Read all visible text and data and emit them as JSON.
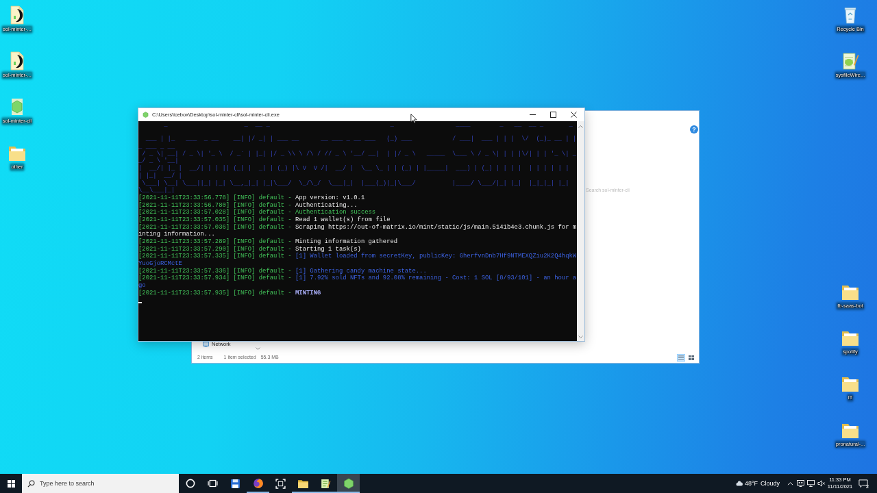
{
  "desktop": {
    "left_icons": [
      {
        "label": "sol-minter-...",
        "kind": "document"
      },
      {
        "label": "sol-minter-...",
        "kind": "document"
      },
      {
        "label": "sol-minter-cli",
        "kind": "hexagon_app"
      },
      {
        "label": "other",
        "kind": "folder"
      }
    ],
    "right_icons": [
      {
        "label": "Recycle Bin",
        "kind": "recycle_bin"
      },
      {
        "label": "sysfileWire...",
        "kind": "notepad"
      },
      {
        "label": "fb-saas-bot",
        "kind": "folder"
      },
      {
        "label": "spotify",
        "kind": "folder"
      },
      {
        "label": "IT",
        "kind": "folder"
      },
      {
        "label": "pronatural-...",
        "kind": "folder"
      }
    ]
  },
  "explorer_window": {
    "help": "?",
    "search": {
      "placeholder": "Search sol-minter-cli"
    },
    "nav_items": [
      {
        "label": "Network",
        "kind": "network"
      }
    ],
    "status_bar": {
      "texts": [
        "2 items",
        "1 item selected",
        "55.3 MB"
      ],
      "view_buttons": [
        {
          "kind": "details",
          "selected": true
        },
        {
          "kind": "tiles",
          "selected": false
        }
      ]
    }
  },
  "console_window": {
    "title": "C:\\Users\\icebox\\Desktop\\sol-minter-cli\\sol-minter-cli.exe",
    "banner": [
      "       _                     _  __ _                                 _                 ____        _   __  __ _       _            ",
      "  ___ | |_   ___  _ __    __| |/ _| | ___ __      __ ___ _ __ ___   (_) ___           / ___|  ___ | | |  \\/  (_)_ __ | |_ ___ _ __ ",
      " / _ \\| __| / _ \\| '_ \\  / _` | |_| |/ _ \\\\ \\ /\\ / // _ \\ '__/ __|  | |/ _ \\   _____  \\___ \\ / _ \\| | | |\\/| | | '_ \\| __/ _ \\ '__|",
      "|  __/| |_ |  __/| | | || (_| |  _| | (_) |\\ V  V /|  __/ |  \\__ \\_ | | (_) | |_____|  ___) | (_) | | | |  | | | | | | | |_|  __/ |  ",
      " \\___| \\__| \\___||_| |_| \\__,_|_| |_|\\___/  \\_/\\_/  \\___|_|  |___(_)|_|\\___/          |____/ \\___/|_| |_|  |_|_|_| |_| \\__\\___|_|  "
    ],
    "log": [
      {
        "prefix": "[2021-11-11T23:33:56.778] [INFO] default -",
        "message": "App version: v1.0.1",
        "kind": "plain"
      },
      {
        "prefix": "[2021-11-11T23:33:56.780] [INFO] default -",
        "message": "Authenticating...",
        "kind": "plain"
      },
      {
        "prefix": "[2021-11-11T23:33:57.028] [INFO] default -",
        "message": "Authentication success",
        "kind": "success"
      },
      {
        "prefix": "[2021-11-11T23:33:57.035] [INFO] default -",
        "message": "Read 1 wallet(s) from file",
        "kind": "plain"
      },
      {
        "prefix": "[2021-11-11T23:33:57.036] [INFO] default -",
        "message": "Scraping https://out-of-matrix.io/mint/static/js/main.5141b4e3.chunk.js for minting information...",
        "kind": "plain"
      },
      {
        "prefix": "[2021-11-11T23:33:57.289] [INFO] default -",
        "message": "Minting information gathered",
        "kind": "plain"
      },
      {
        "prefix": "[2021-11-11T23:33:57.290] [INFO] default -",
        "message": "Starting 1 task(s)",
        "kind": "plain"
      },
      {
        "prefix": "[2021-11-11T23:33:57.335] [INFO] default -",
        "message": "[1] Wallet loaded from secretKey, publicKey: GherfvnDnb7Hf9NTMEXQZiu2K2Q4hqkWYuoGjoRCMctE",
        "kind": "task"
      },
      {
        "prefix": "[2021-11-11T23:33:57.336] [INFO] default -",
        "message": "[1] Gathering candy machine state...",
        "kind": "task"
      },
      {
        "prefix": "[2021-11-11T23:33:57.934] [INFO] default -",
        "message": "[1] 7.92% sold NFTs and 92.08% remaining - Cost: 1 SOL [8/93/101] - an hour ago",
        "kind": "task"
      },
      {
        "prefix": "[2021-11-11T23:33:57.935] [INFO] default -",
        "message": "MINTING",
        "kind": "highlight"
      }
    ]
  },
  "taskbar": {
    "search": {
      "placeholder": "Type here to search"
    },
    "apps": [
      {
        "kind": "cortana",
        "active": false,
        "running": false
      },
      {
        "kind": "task_view",
        "active": false,
        "running": false
      },
      {
        "kind": "floppy",
        "active": false,
        "running": false
      },
      {
        "kind": "browser",
        "active": false,
        "running": true
      },
      {
        "kind": "snip",
        "active": false,
        "running": false
      },
      {
        "kind": "folder",
        "active": false,
        "running": true
      },
      {
        "kind": "notepad",
        "active": false,
        "running": true
      },
      {
        "kind": "hexagon",
        "active": true,
        "running": true
      }
    ],
    "weather": {
      "temperature": "48°F",
      "condition": "Cloudy"
    },
    "tray_icons": [
      {
        "kind": "chevron"
      },
      {
        "kind": "display"
      },
      {
        "kind": "monitor"
      },
      {
        "kind": "speaker_muted"
      }
    ],
    "clock": {
      "time": "11:33 PM",
      "date": "11/11/2021"
    },
    "notifications": {
      "count": "2"
    }
  }
}
